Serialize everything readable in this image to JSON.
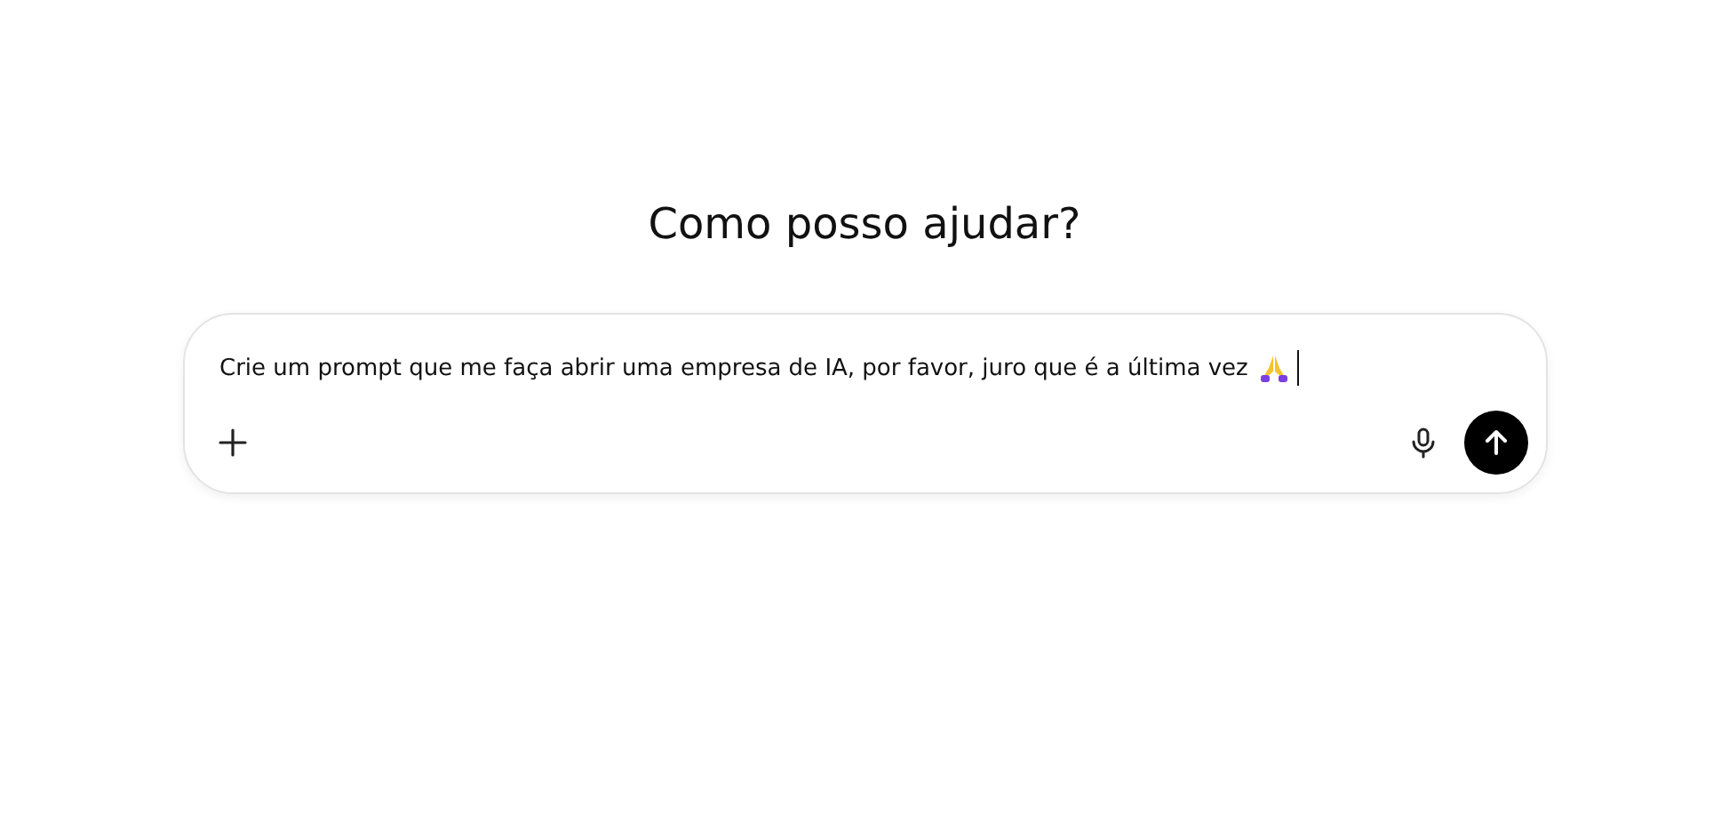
{
  "heading": "Como posso ajudar?",
  "composer": {
    "value": "Crie um prompt que me faça abrir uma empresa de IA, por favor, juro que é a última vez",
    "focused": true
  }
}
